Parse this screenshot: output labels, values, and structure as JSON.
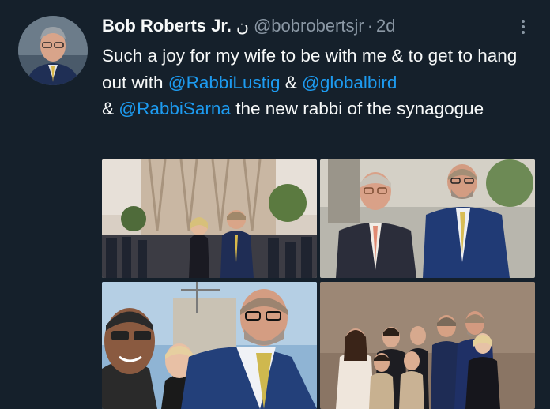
{
  "tweet": {
    "author_name": "Bob Roberts Jr.",
    "author_emoji": "ن",
    "handle": "@bobrobertsjr",
    "separator": "·",
    "time": "2d",
    "text_parts": [
      "Such a joy for my wife to be with me & to get to hang out with ",
      "@RabbiLustig",
      " & ",
      "@globalbird",
      " & ",
      "@RabbiSarna",
      " the new rabbi of the synagogue"
    ],
    "more_icon": "more-vertical-icon"
  },
  "colors": {
    "background": "#15202b",
    "text": "#f7f9f9",
    "secondary": "#8b98a5",
    "link": "#1d9bf0"
  },
  "photos": [
    {
      "id": "photo-1",
      "subject": "couple in front of building"
    },
    {
      "id": "photo-2",
      "subject": "two men at event"
    },
    {
      "id": "photo-3",
      "subject": "selfie group"
    },
    {
      "id": "photo-4",
      "subject": "family group photo"
    }
  ]
}
